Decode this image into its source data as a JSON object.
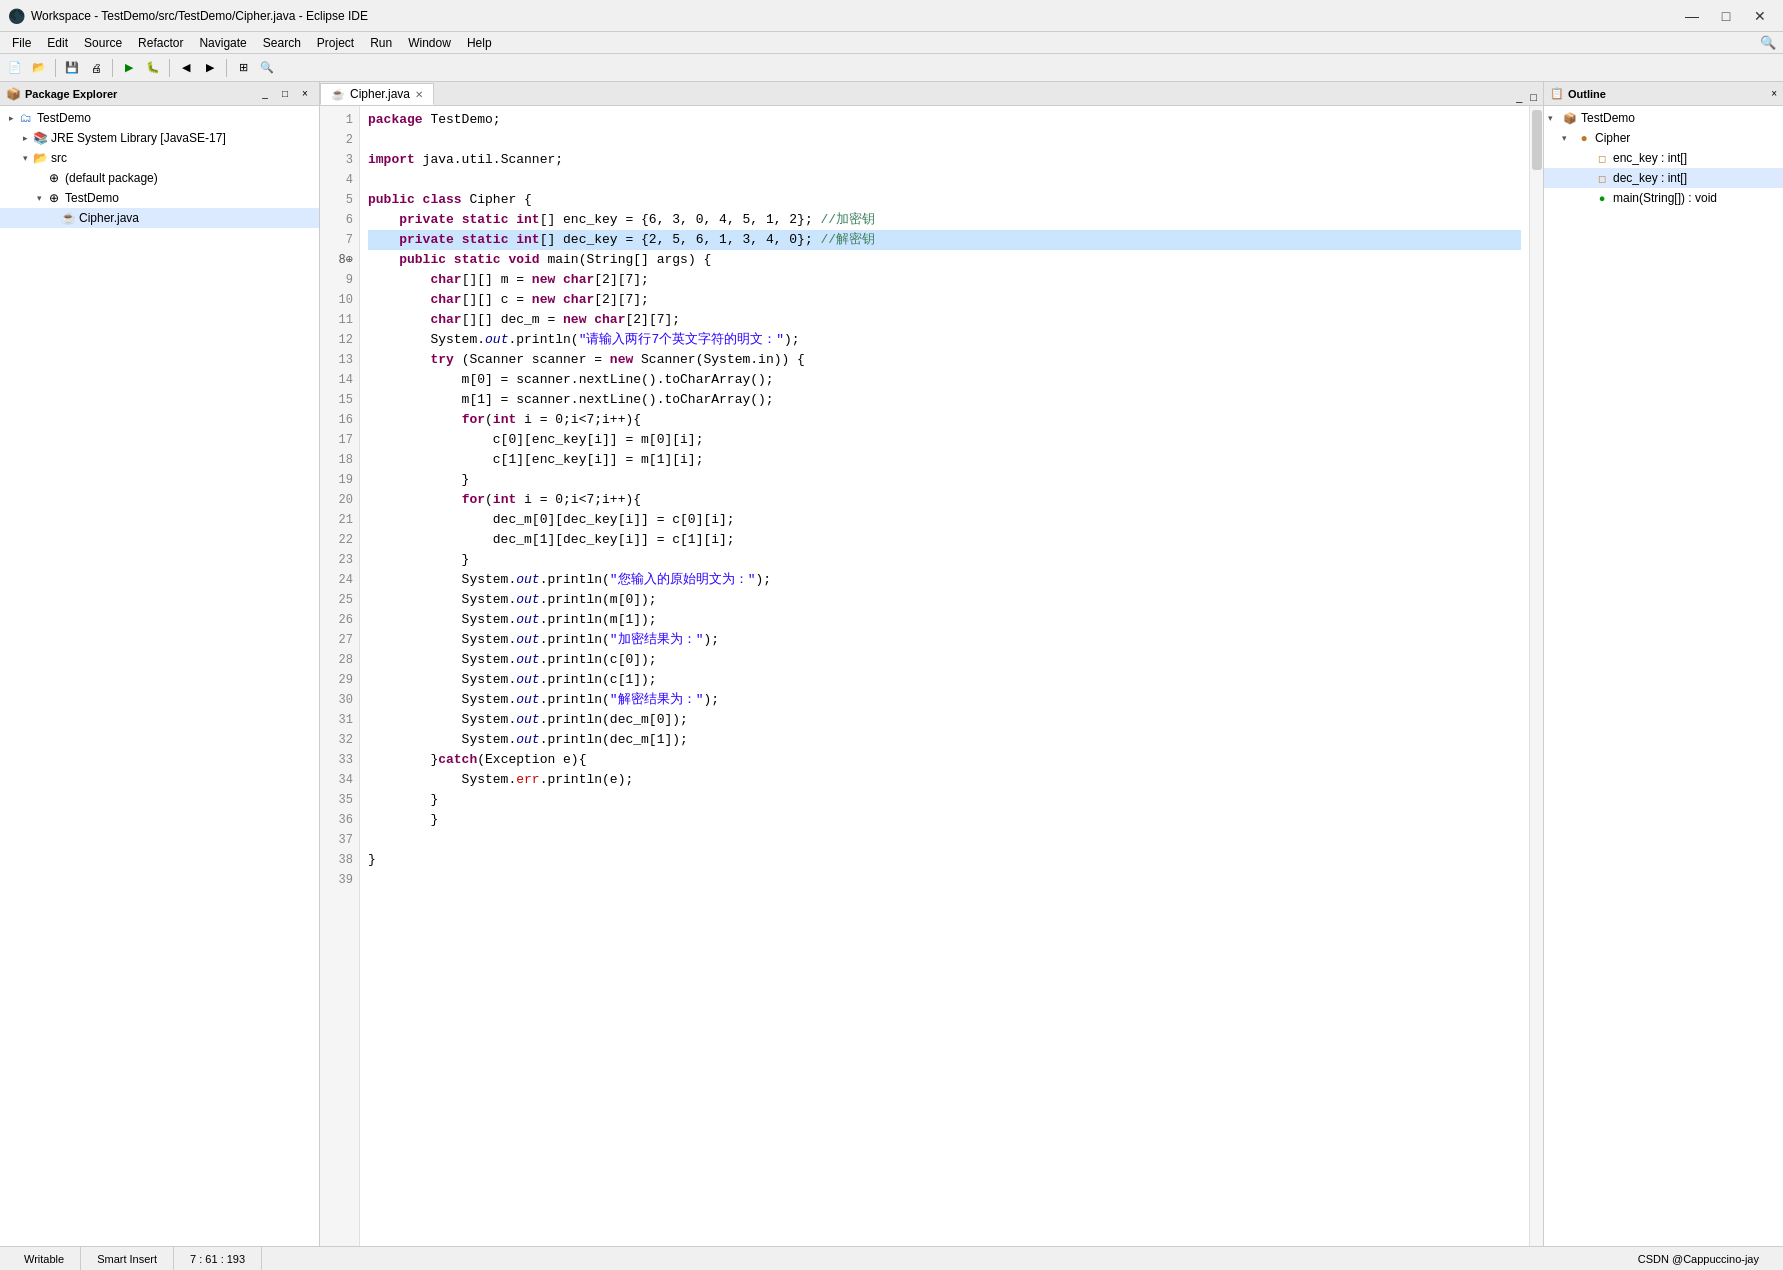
{
  "window": {
    "title": "Workspace - TestDemo/src/TestDemo/Cipher.java - Eclipse IDE",
    "icon": "🌑"
  },
  "menu": {
    "items": [
      "File",
      "Edit",
      "Source",
      "Refactor",
      "Navigate",
      "Search",
      "Project",
      "Run",
      "Window",
      "Help"
    ]
  },
  "package_explorer": {
    "title": "Package Explorer",
    "tree": [
      {
        "id": "testdemo-root",
        "label": "TestDemo",
        "indent": 0,
        "arrow": "▸",
        "icon": "📁",
        "type": "project"
      },
      {
        "id": "jre",
        "label": "JRE System Library [JavaSE-17]",
        "indent": 1,
        "arrow": "▸",
        "icon": "📚",
        "type": "jre"
      },
      {
        "id": "src",
        "label": "src",
        "indent": 1,
        "arrow": "▾",
        "icon": "📂",
        "type": "folder"
      },
      {
        "id": "default-pkg",
        "label": "(default package)",
        "indent": 2,
        "arrow": "",
        "icon": "📦",
        "type": "package"
      },
      {
        "id": "testdemo-pkg",
        "label": "TestDemo",
        "indent": 2,
        "arrow": "▾",
        "icon": "📦",
        "type": "package"
      },
      {
        "id": "cipher-file",
        "label": "Cipher.java",
        "indent": 3,
        "arrow": "",
        "icon": "☕",
        "type": "java",
        "selected": true
      }
    ]
  },
  "editor": {
    "tab_label": "Cipher.java",
    "lines": [
      {
        "num": 1,
        "code": "package TestDemo;"
      },
      {
        "num": 2,
        "code": ""
      },
      {
        "num": 3,
        "code": "import java.util.Scanner;"
      },
      {
        "num": 4,
        "code": ""
      },
      {
        "num": 5,
        "code": "public class Cipher {"
      },
      {
        "num": 6,
        "code": "    private static int[] enc_key = {6, 3, 0, 4, 5, 1, 2}; //加密钥"
      },
      {
        "num": 7,
        "code": "    private static int[] dec_key = {2, 5, 6, 1, 3, 4, 0}; //解密钥",
        "highlighted": true
      },
      {
        "num": 8,
        "code": "    public static void main(String[] args) {",
        "breakpoint": true
      },
      {
        "num": 9,
        "code": "        char[][] m = new char[2][7];"
      },
      {
        "num": 10,
        "code": "        char[][] c = new char[2][7];"
      },
      {
        "num": 11,
        "code": "        char[][] dec_m = new char[2][7];"
      },
      {
        "num": 12,
        "code": "        System.out.println(\"请输入两行7个英文字符的明文：\");"
      },
      {
        "num": 13,
        "code": "        try (Scanner scanner = new Scanner(System.in)) {"
      },
      {
        "num": 14,
        "code": "            m[0] = scanner.nextLine().toCharArray();"
      },
      {
        "num": 15,
        "code": "            m[1] = scanner.nextLine().toCharArray();"
      },
      {
        "num": 16,
        "code": "            for(int i = 0;i<7;i++){"
      },
      {
        "num": 17,
        "code": "                c[0][enc_key[i]] = m[0][i];"
      },
      {
        "num": 18,
        "code": "                c[1][enc_key[i]] = m[1][i];"
      },
      {
        "num": 19,
        "code": "            }"
      },
      {
        "num": 20,
        "code": "            for(int i = 0;i<7;i++){"
      },
      {
        "num": 21,
        "code": "                dec_m[0][dec_key[i]] = c[0][i];"
      },
      {
        "num": 22,
        "code": "                dec_m[1][dec_key[i]] = c[1][i];"
      },
      {
        "num": 23,
        "code": "            }"
      },
      {
        "num": 24,
        "code": "            System.out.println(\"您输入的原始明文为：\");"
      },
      {
        "num": 25,
        "code": "            System.out.println(m[0]);"
      },
      {
        "num": 26,
        "code": "            System.out.println(m[1]);"
      },
      {
        "num": 27,
        "code": "            System.out.println(\"加密结果为：\");"
      },
      {
        "num": 28,
        "code": "            System.out.println(c[0]);"
      },
      {
        "num": 29,
        "code": "            System.out.println(c[1]);"
      },
      {
        "num": 30,
        "code": "            System.out.println(\"解密结果为：\");"
      },
      {
        "num": 31,
        "code": "            System.out.println(dec_m[0]);"
      },
      {
        "num": 32,
        "code": "            System.out.println(dec_m[1]);"
      },
      {
        "num": 33,
        "code": "        }catch(Exception e){"
      },
      {
        "num": 34,
        "code": "            System.err.println(e);"
      },
      {
        "num": 35,
        "code": "        }"
      },
      {
        "num": 36,
        "code": "        }"
      },
      {
        "num": 37,
        "code": ""
      },
      {
        "num": 38,
        "code": "}"
      },
      {
        "num": 39,
        "code": ""
      }
    ]
  },
  "outline": {
    "title": "Outline",
    "items": [
      {
        "id": "testdemo-node",
        "label": "TestDemo",
        "indent": 0,
        "arrow": "▾",
        "icon_type": "package"
      },
      {
        "id": "cipher-class",
        "label": "Cipher",
        "indent": 1,
        "arrow": "▾",
        "icon_type": "class"
      },
      {
        "id": "enc-key",
        "label": "enc_key : int[]",
        "indent": 2,
        "arrow": "",
        "icon_type": "field"
      },
      {
        "id": "dec-key",
        "label": "dec_key : int[]",
        "indent": 2,
        "arrow": "",
        "icon_type": "field",
        "selected": true
      },
      {
        "id": "main-method",
        "label": "main(String[]) : void",
        "indent": 2,
        "arrow": "",
        "icon_type": "method"
      }
    ]
  },
  "status_bar": {
    "writable": "Writable",
    "smart_insert": "Smart Insert",
    "position": "7 : 61 : 193",
    "credit": "CSDN @Cappuccino-jay"
  }
}
